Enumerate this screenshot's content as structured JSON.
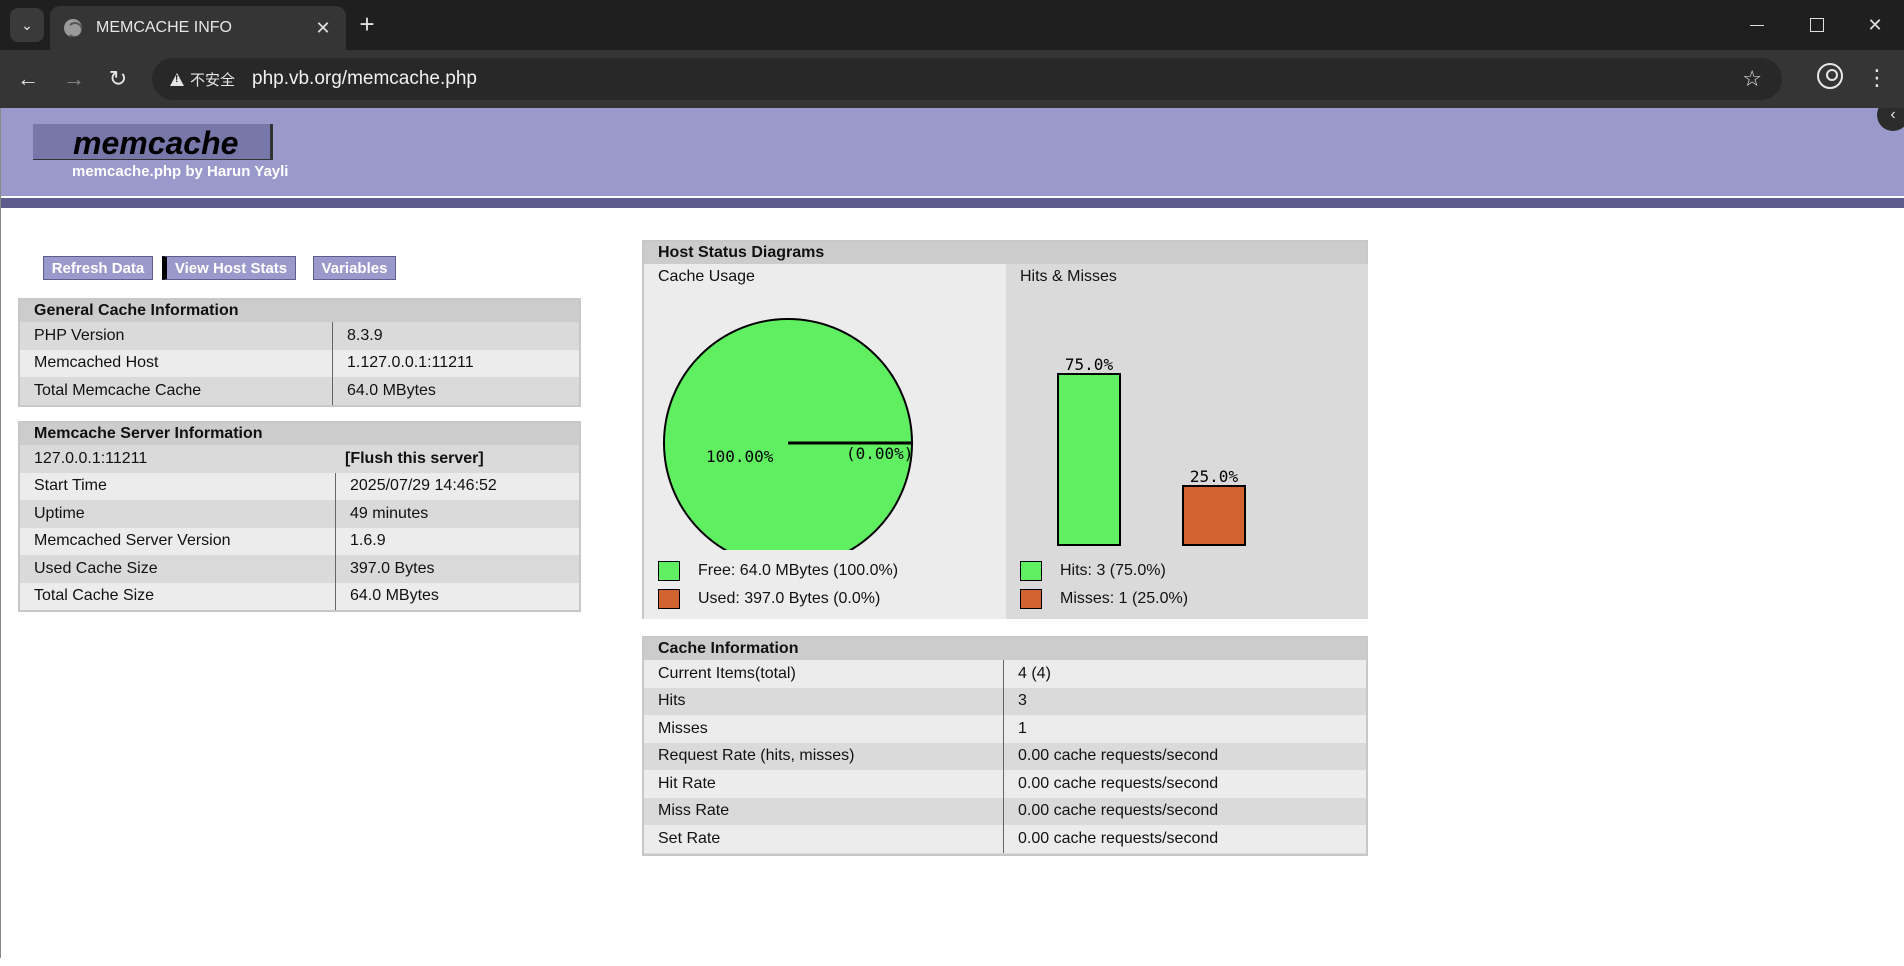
{
  "browser": {
    "tab_title": "MEMCACHE INFO",
    "security_label": "不安全",
    "url": "php.vb.org/memcache.php"
  },
  "header": {
    "logo": "memcache",
    "subtitle": "memcache.php by Harun Yayli"
  },
  "menu": {
    "refresh": "Refresh Data",
    "host_stats": "View Host Stats",
    "variables": "Variables"
  },
  "general": {
    "title": "General Cache Information",
    "rows": [
      {
        "k": "PHP Version",
        "v": "8.3.9"
      },
      {
        "k": "Memcached Host",
        "v": "1.127.0.0.1:11211"
      },
      {
        "k": "Total Memcache Cache",
        "v": "64.0 MBytes"
      }
    ]
  },
  "server": {
    "title": "Memcache Server Information",
    "host": "127.0.0.1:11211",
    "flush": "[Flush this server]",
    "rows": [
      {
        "k": "Start Time",
        "v": "2025/07/29 14:46:52"
      },
      {
        "k": "Uptime",
        "v": "49 minutes"
      },
      {
        "k": "Memcached Server Version",
        "v": "1.6.9"
      },
      {
        "k": "Used Cache Size",
        "v": "397.0 Bytes"
      },
      {
        "k": "Total Cache Size",
        "v": "64.0 MBytes"
      }
    ]
  },
  "diagrams": {
    "title": "Host Status Diagrams",
    "cache_usage": {
      "label": "Cache Usage",
      "free_label": "Free: 64.0 MBytes (100.0%)",
      "used_label": "Used: 397.0 Bytes (0.0%)"
    },
    "hits_misses": {
      "label": "Hits & Misses",
      "hits_label": "Hits: 3 (75.0%)",
      "misses_label": "Misses: 1 (25.0%)"
    },
    "colors": {
      "green": "#60ef60",
      "orange": "#d2622f"
    }
  },
  "chart_data": [
    {
      "type": "pie",
      "categories": [
        "Free",
        "Used"
      ],
      "values": [
        100.0,
        0.0
      ],
      "labels": [
        "100.00%",
        "(0.00%)"
      ]
    },
    {
      "type": "bar",
      "categories": [
        "Hits",
        "Misses"
      ],
      "values": [
        75.0,
        25.0
      ],
      "labels": [
        "75.0%",
        "25.0%"
      ]
    }
  ],
  "cache_info": {
    "title": "Cache Information",
    "rows": [
      {
        "k": "Current Items(total)",
        "v": "4 (4)"
      },
      {
        "k": "Hits",
        "v": "3"
      },
      {
        "k": "Misses",
        "v": "1"
      },
      {
        "k": "Request Rate (hits, misses)",
        "v": "0.00 cache requests/second"
      },
      {
        "k": "Hit Rate",
        "v": "0.00 cache requests/second"
      },
      {
        "k": "Miss Rate",
        "v": "0.00 cache requests/second"
      },
      {
        "k": "Set Rate",
        "v": "0.00 cache requests/second"
      }
    ]
  }
}
